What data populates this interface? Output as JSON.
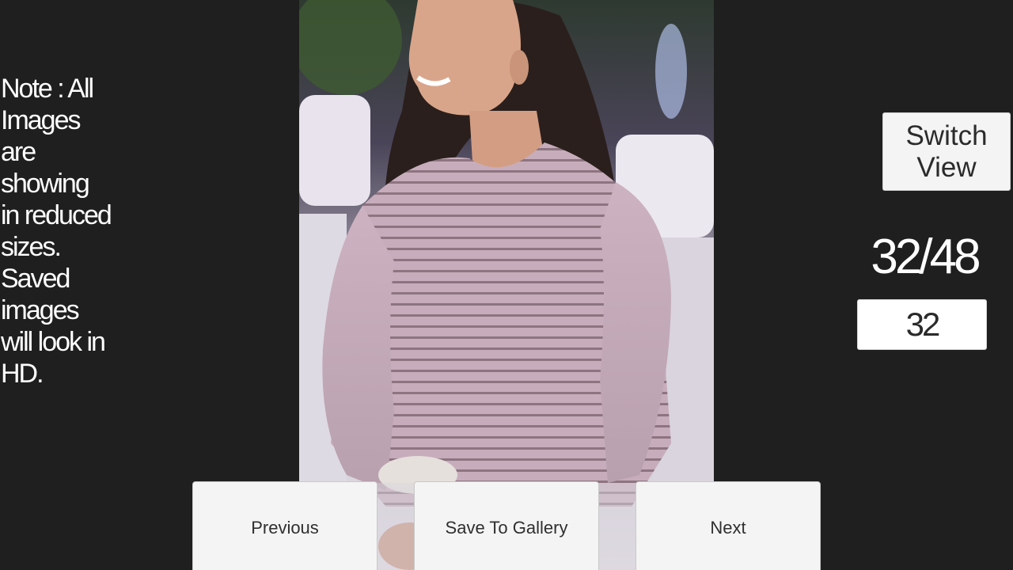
{
  "note": {
    "text": "Note : All Images are showing in reduced sizes. Saved images will look in HD."
  },
  "photo": {
    "description_icon": "photo-image"
  },
  "switch_view": {
    "label": "Switch View"
  },
  "counter": {
    "text": "32/48"
  },
  "page_input": {
    "value": "32"
  },
  "bottom_bar": {
    "previous_label": "Previous",
    "save_label": "Save To Gallery",
    "next_label": "Next"
  },
  "colors": {
    "background": "#1f1f1f",
    "button_bg": "#f4f4f4",
    "text_light": "#ffffff",
    "text_dark": "#2f2f2f"
  }
}
